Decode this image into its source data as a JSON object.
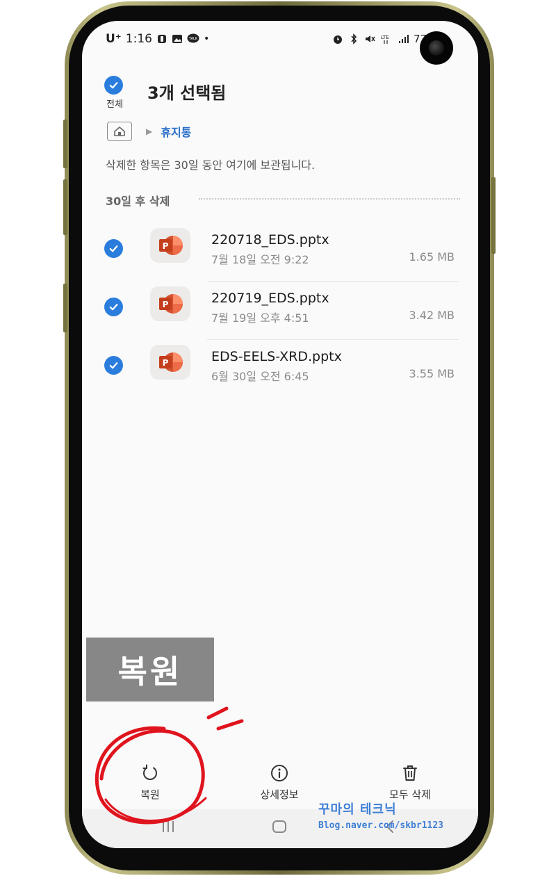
{
  "status_bar": {
    "carrier": "U⁺",
    "time": "1:16",
    "battery": "77"
  },
  "header": {
    "select_all_label": "전체",
    "title": "3개 선택됨"
  },
  "breadcrumb": {
    "arrow": "▶",
    "folder": "휴지통"
  },
  "notice": "삭제한 항목은 30일 동안 여기에 보관됩니다.",
  "section_title": "30일 후 삭제",
  "files": [
    {
      "name": "220718_EDS.pptx",
      "date": "7월 18일 오전 9:22",
      "size": "1.65 MB",
      "selected": true
    },
    {
      "name": "220719_EDS.pptx",
      "date": "7월 19일 오후 4:51",
      "size": "3.42 MB",
      "selected": true
    },
    {
      "name": "EDS-EELS-XRD.pptx",
      "date": "6월 30일 오전 6:45",
      "size": "3.55 MB",
      "selected": true
    }
  ],
  "overlay_label": "복원",
  "bottom_bar": {
    "restore": "복원",
    "details": "상세정보",
    "delete_all": "모두 삭제"
  },
  "watermark": {
    "line1": "꾸마의 테크닉",
    "line2": "Blog.naver.com/skbr1123"
  },
  "colors": {
    "accent": "#2a7ddc",
    "ppt_orange": "#d35230",
    "annotation_red": "#e0141e"
  },
  "icons": [
    "restore-icon",
    "info-icon",
    "trash-icon",
    "home-icon",
    "powerpoint-icon",
    "check-icon",
    "recents-nav-icon",
    "home-nav-icon",
    "back-nav-icon"
  ]
}
